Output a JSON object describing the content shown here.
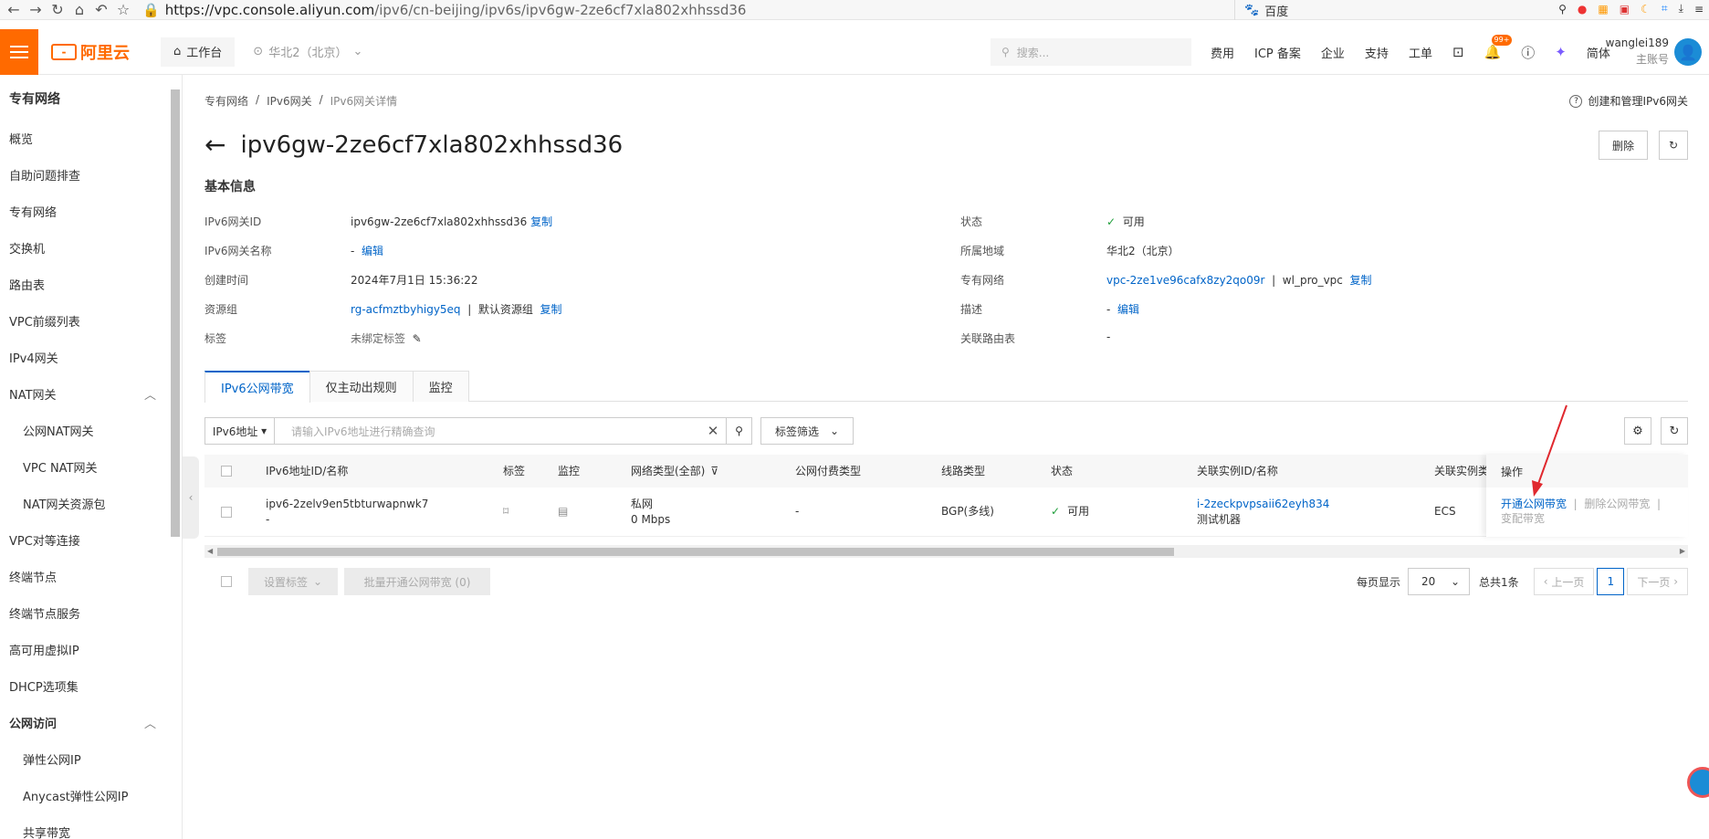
{
  "browser": {
    "url_host": "https://vpc.console.aliyun.com",
    "url_path": "/ipv6/cn-beijing/ipv6s/ipv6gw-2ze6cf7xla802xhhssd36",
    "search_engine": "百度"
  },
  "topnav": {
    "logo_text": "阿里云",
    "workbench": "工作台",
    "region": "华北2（北京）",
    "search_placeholder": "搜索...",
    "links": [
      "费用",
      "ICP 备案",
      "企业",
      "支持",
      "工单"
    ],
    "badge": "99+",
    "lang": "简体",
    "user_name": "wanglei189",
    "user_role": "主账号"
  },
  "sidebar": {
    "title": "专有网络",
    "items": [
      {
        "label": "概览",
        "level": "top"
      },
      {
        "label": "自助问题排查",
        "level": "top"
      },
      {
        "label": "专有网络",
        "level": "top"
      },
      {
        "label": "交换机",
        "level": "top"
      },
      {
        "label": "路由表",
        "level": "top"
      },
      {
        "label": "VPC前缀列表",
        "level": "top"
      },
      {
        "label": "IPv4网关",
        "level": "top"
      },
      {
        "label": "NAT网关",
        "level": "group"
      },
      {
        "label": "公网NAT网关",
        "level": "sub"
      },
      {
        "label": "VPC NAT网关",
        "level": "sub"
      },
      {
        "label": "NAT网关资源包",
        "level": "sub"
      },
      {
        "label": "VPC对等连接",
        "level": "top"
      },
      {
        "label": "终端节点",
        "level": "top"
      },
      {
        "label": "终端节点服务",
        "level": "top"
      },
      {
        "label": "高可用虚拟IP",
        "level": "top"
      },
      {
        "label": "DHCP选项集",
        "level": "top"
      },
      {
        "label": "公网访问",
        "level": "groupbold"
      },
      {
        "label": "弹性公网IP",
        "level": "sub"
      },
      {
        "label": "Anycast弹性公网IP",
        "level": "sub"
      },
      {
        "label": "共享带宽",
        "level": "sub"
      }
    ]
  },
  "breadcrumb": [
    "专有网络",
    "IPv6网关",
    "IPv6网关详情"
  ],
  "help_link": "创建和管理IPv6网关",
  "page_title": "ipv6gw-2ze6cf7xla802xhhssd36",
  "actions": {
    "delete": "删除"
  },
  "basic_info": {
    "section_title": "基本信息",
    "left": [
      {
        "key": "IPv6网关ID",
        "value": "ipv6gw-2ze6cf7xla802xhhssd36",
        "extra": "复制"
      },
      {
        "key": "IPv6网关名称",
        "value": "-",
        "extra": "编辑"
      },
      {
        "key": "创建时间",
        "value": "2024年7月1日 15:36:22",
        "extra": ""
      },
      {
        "key": "资源组",
        "value": "rg-acfmztbyhigy5eq",
        "sep": "|",
        "value2": "默认资源组",
        "extra": "复制"
      },
      {
        "key": "标签",
        "value": "未绑定标签",
        "extra": ""
      }
    ],
    "right": [
      {
        "key": "状态",
        "value": "可用"
      },
      {
        "key": "所属地域",
        "value": "华北2（北京）"
      },
      {
        "key": "专有网络",
        "value": "vpc-2ze1ve96cafx8zy2qo09r",
        "sep": "|",
        "value2": "wl_pro_vpc",
        "extra": "复制"
      },
      {
        "key": "描述",
        "value": "-",
        "extra": "编辑"
      },
      {
        "key": "关联路由表",
        "value": "-"
      }
    ]
  },
  "tabs": [
    "IPv6公网带宽",
    "仅主动出规则",
    "监控"
  ],
  "filter": {
    "select": "IPv6地址",
    "placeholder": "请输入IPv6地址进行精确查询",
    "tag_filter": "标签筛选"
  },
  "table": {
    "headers": [
      "IPv6地址ID/名称",
      "标签",
      "监控",
      "网络类型(全部)",
      "公网付费类型",
      "线路类型",
      "状态",
      "关联实例ID/名称",
      "关联实例类"
    ],
    "op_header": "操作",
    "rows": [
      {
        "id": "ipv6-2zelv9en5tbturwapnwk7",
        "name": "-",
        "net_type": "私网",
        "bandwidth": "0 Mbps",
        "pay_type": "-",
        "line_type": "BGP(多线)",
        "status": "可用",
        "instance_id": "i-2zeckpvpsaii62eyh834",
        "instance_name": "测试机器",
        "instance_type": "ECS",
        "op_open": "开通公网带宽",
        "op_delete": "删除公网带宽",
        "op_change": "变配带宽"
      }
    ]
  },
  "footer": {
    "set_tag": "设置标签",
    "batch_open": "批量开通公网带宽 (0)",
    "per_page_label": "每页显示",
    "per_page": "20",
    "total": "总共1条",
    "prev": "上一页",
    "page": "1",
    "next": "下一页"
  },
  "colors": {
    "accent": "#ff6a00",
    "link": "#0064c8",
    "ok": "#1e9e3a",
    "arrow": "#e0282e"
  }
}
